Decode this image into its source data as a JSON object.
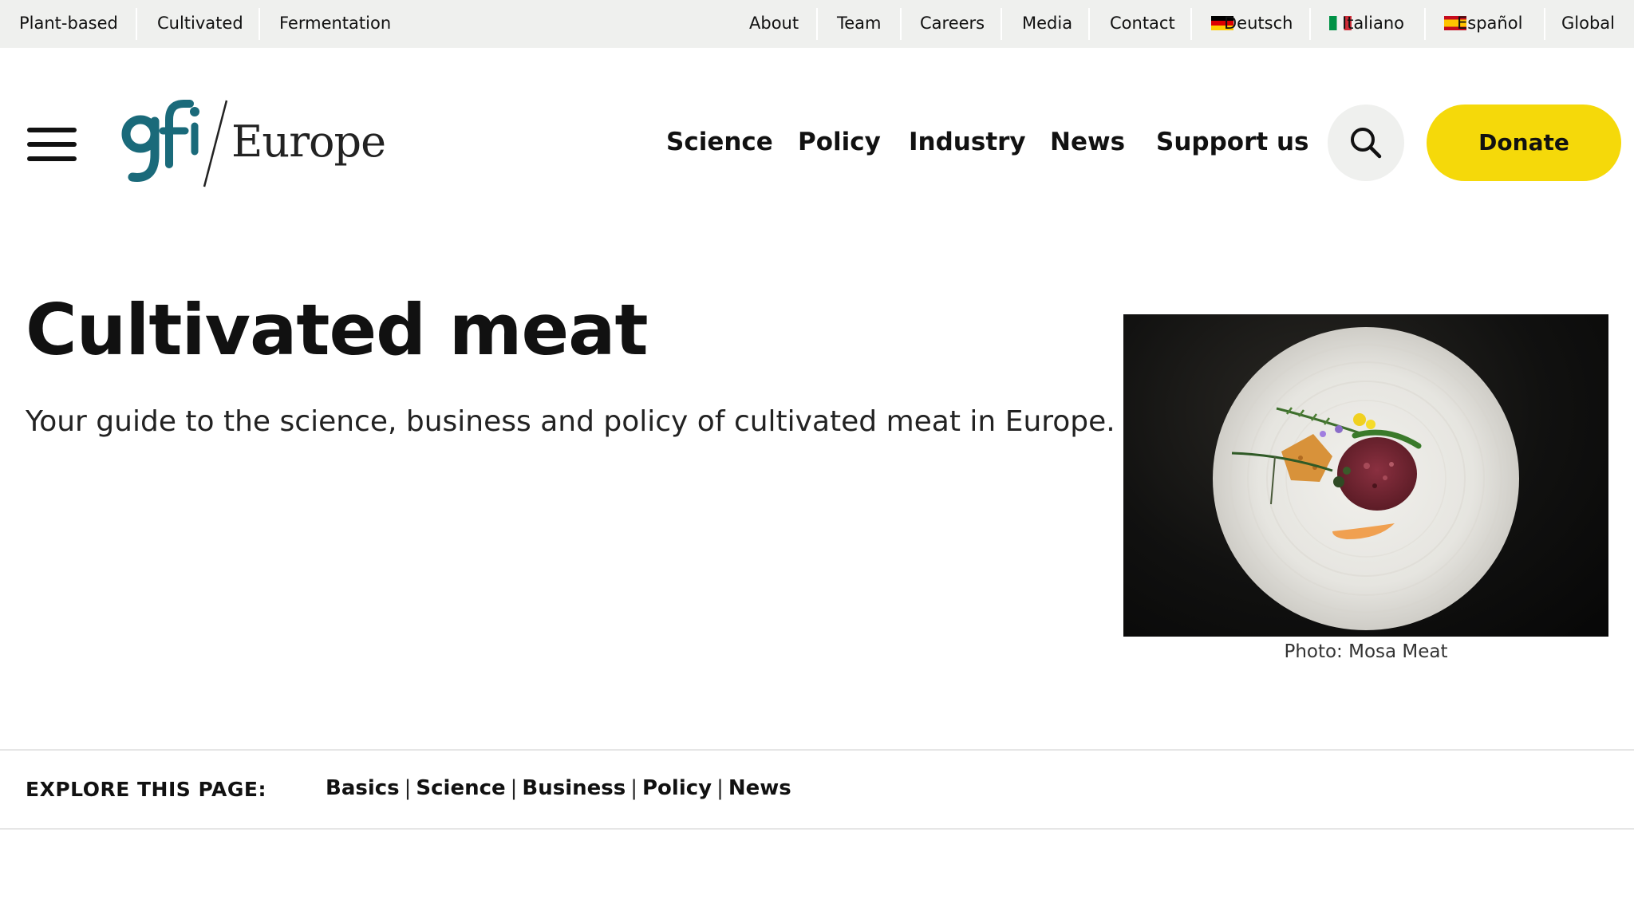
{
  "topbar": {
    "left_links": [
      "Plant-based",
      "Cultivated",
      "Fermentation"
    ],
    "right_links": [
      "About",
      "Team",
      "Careers",
      "Media",
      "Contact"
    ],
    "languages": [
      {
        "label": "Deutsch",
        "flag": "german-flag-icon"
      },
      {
        "label": "Italiano",
        "flag": "italian-flag-icon"
      },
      {
        "label": "Español",
        "flag": "spanish-flag-icon"
      }
    ],
    "global": "Global"
  },
  "header": {
    "logo_mark": "gfi",
    "logo_wordmark": "Europe",
    "nav": [
      "Science",
      "Policy",
      "Industry",
      "News",
      "Support us"
    ],
    "donate_label": "Donate",
    "icons": {
      "menu": "hamburger-menu-icon",
      "search": "search-icon"
    }
  },
  "hero": {
    "title": "Cultivated meat",
    "subtitle": "Your guide to the science, business and policy of cultivated meat in Europe.",
    "photo_caption": "Photo: Mosa Meat"
  },
  "explore": {
    "label": "EXPLORE THIS PAGE:",
    "links": [
      "Basics",
      "Science",
      "Business",
      "Policy",
      "News"
    ]
  },
  "colors": {
    "brand_teal": "#1a6a7a",
    "donate_yellow": "#f5d90a",
    "topbar_bg": "#eff0ee"
  }
}
